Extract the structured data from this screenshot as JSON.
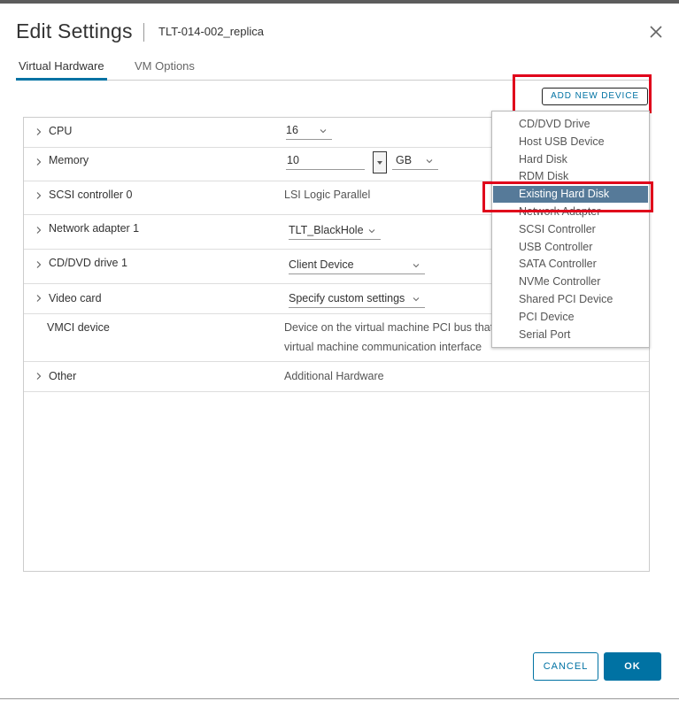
{
  "header": {
    "title": "Edit Settings",
    "vm_name": "TLT-014-002_replica"
  },
  "tabs": [
    {
      "label": "Virtual Hardware",
      "active": true
    },
    {
      "label": "VM Options",
      "active": false
    }
  ],
  "add_new_device_label": "ADD NEW DEVICE",
  "hardware": {
    "cpu": {
      "label": "CPU",
      "value": "16"
    },
    "memory": {
      "label": "Memory",
      "value": "10",
      "unit": "GB"
    },
    "scsi": {
      "label": "SCSI controller 0",
      "value": "LSI Logic Parallel"
    },
    "network": {
      "label": "Network adapter 1",
      "value": "TLT_BlackHole"
    },
    "cddvd": {
      "label": "CD/DVD drive 1",
      "value": "Client Device"
    },
    "video": {
      "label": "Video card",
      "value": "Specify custom settings"
    },
    "vmci": {
      "label": "VMCI device",
      "value_line1": "Device on the virtual machine PCI bus that",
      "value_line2": "virtual machine communication interface"
    },
    "other": {
      "label": "Other",
      "value": "Additional Hardware"
    }
  },
  "device_menu": [
    {
      "label": "CD/DVD Drive"
    },
    {
      "label": "Host USB Device"
    },
    {
      "label": "Hard Disk"
    },
    {
      "label": "RDM Disk"
    },
    {
      "label": "Existing Hard Disk",
      "highlighted": true
    },
    {
      "label": "Network Adapter"
    },
    {
      "label": "SCSI Controller"
    },
    {
      "label": "USB Controller"
    },
    {
      "label": "SATA Controller"
    },
    {
      "label": "NVMe Controller"
    },
    {
      "label": "Shared PCI Device"
    },
    {
      "label": "PCI Device"
    },
    {
      "label": "Serial Port"
    }
  ],
  "footer": {
    "cancel_label": "CANCEL",
    "ok_label": "OK"
  },
  "colors": {
    "accent": "#0072a3",
    "highlight": "#567a99",
    "annotation": "#e0001b"
  },
  "icons": {
    "close": "close-icon",
    "expand": "chevron-right-icon",
    "dropdown": "chevron-down-icon"
  }
}
